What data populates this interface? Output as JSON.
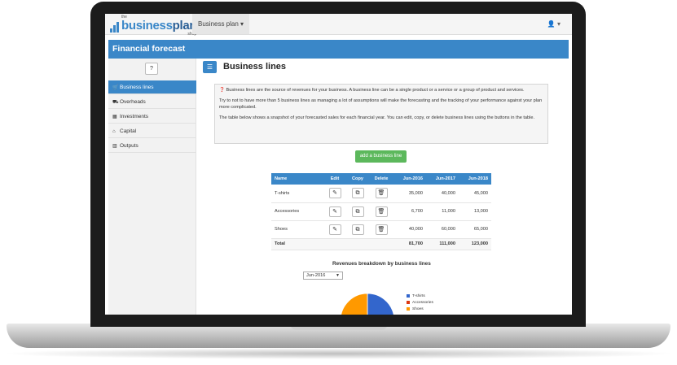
{
  "app": {
    "logo": {
      "small_top": "the",
      "brand_a": "business",
      "brand_b": "plan",
      "small_bottom": "shop"
    },
    "nav_dropdown": "Business plan ▾",
    "user_menu": "▾"
  },
  "page": {
    "banner_title": "Financial forecast",
    "help_label": "?",
    "section_title": "Business lines"
  },
  "sidebar": {
    "items": [
      {
        "label": "Business lines",
        "icon": "cart-icon",
        "active": true
      },
      {
        "label": "Overheads",
        "icon": "truck-icon",
        "active": false
      },
      {
        "label": "Investments",
        "icon": "building-icon",
        "active": false
      },
      {
        "label": "Capital",
        "icon": "bank-icon",
        "active": false
      },
      {
        "label": "Outputs",
        "icon": "bar-chart-icon",
        "active": false
      }
    ]
  },
  "info": {
    "p1": "Business lines are the source of revenues for your business. A business line can be a single product or a service or a group of product and services.",
    "p2": "Try to not to have more than 5 business lines as managing a lot of assumptions will make the forecasting and the tracking of your performance against your plan more complicated.",
    "p3": "The table below shows a snapshot of your forecasted sales for each financial year. You can edit, copy, or delete business lines using the buttons in the table."
  },
  "add_button": "add a business line",
  "table": {
    "headers": [
      "Name",
      "Edit",
      "Copy",
      "Delete",
      "Jun-2016",
      "Jun-2017",
      "Jun-2018"
    ],
    "rows": [
      {
        "name": "T-shirts",
        "values": [
          "35,000",
          "40,000",
          "45,000"
        ]
      },
      {
        "name": "Accessories",
        "values": [
          "6,700",
          "11,000",
          "13,000"
        ]
      },
      {
        "name": "Shoes",
        "values": [
          "40,000",
          "60,000",
          "65,000"
        ]
      }
    ],
    "total": {
      "label": "Total",
      "values": [
        "81,700",
        "111,000",
        "123,000"
      ]
    }
  },
  "chart": {
    "title": "Revenues breakdown by business lines",
    "selected_period": "Jun-2016",
    "legend": [
      {
        "name": "T-shirts",
        "color": "#3366cc"
      },
      {
        "name": "Accessories",
        "color": "#dc3912"
      },
      {
        "name": "Shoes",
        "color": "#ff9900"
      }
    ]
  },
  "chart_data": {
    "type": "pie",
    "categories": [
      "T-shirts",
      "Accessories",
      "Shoes"
    ],
    "values": [
      35000,
      6700,
      40000
    ],
    "title": "Revenues breakdown by business lines",
    "colors": [
      "#3366cc",
      "#dc3912",
      "#ff9900"
    ],
    "legend": "right"
  }
}
